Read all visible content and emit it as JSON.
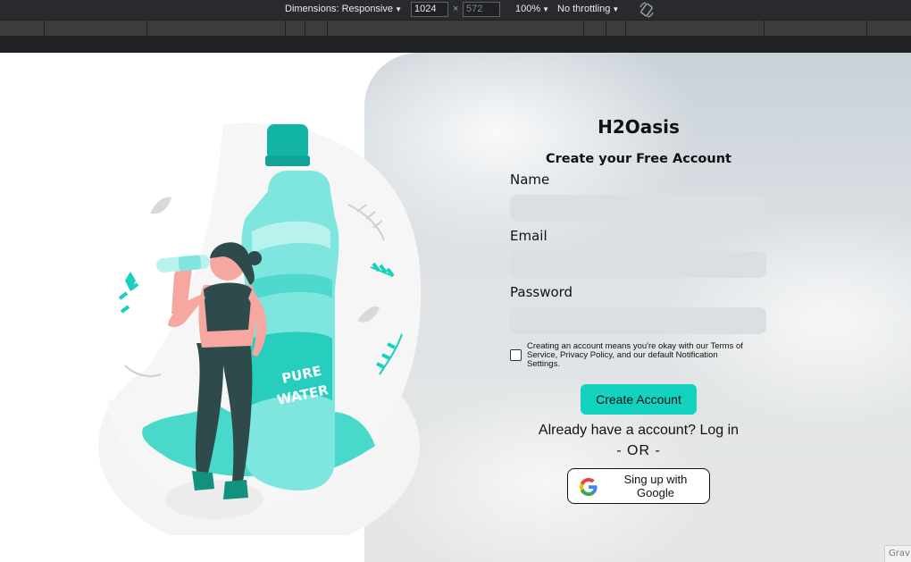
{
  "devtools": {
    "dimensions_label": "Dimensions: Responsive",
    "width_value": "1024",
    "x_sep": "×",
    "height_value": "572",
    "zoom": "100%",
    "throttling": "No throttling"
  },
  "illustration": {
    "label_top": "PURE",
    "label_bottom": "WATER"
  },
  "signup": {
    "brand": "H2Oasis",
    "subtitle": "Create your Free Account",
    "name_label": "Name",
    "email_label": "Email",
    "password_label": "Password",
    "terms_text": "Creating an account means you're okay with our Terms of Service, Privacy Policy, and our default Notification Settings.",
    "create_button": "Create Account",
    "login_prompt": "Already have a account? Log in",
    "or_divider": "- OR -",
    "google_button": "Sing up with Google"
  },
  "overlay": {
    "corner_badge": "Grav"
  },
  "colors": {
    "accent": "#13d3c0",
    "field_bg": "#dcdfe2",
    "devtools_bg": "#292a2d"
  }
}
